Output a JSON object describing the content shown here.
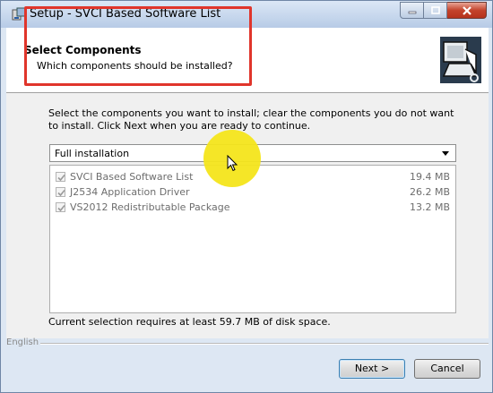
{
  "window": {
    "title": "Setup - SVCI Based Software List"
  },
  "header": {
    "title": "Select Components",
    "subtitle": "Which components should be installed?"
  },
  "main": {
    "instructions": "Select the components you want to install; clear the components you do not want to install. Click Next when you are ready to continue.",
    "install_type": "Full installation",
    "components": [
      {
        "label": "SVCI Based Software List",
        "size": "19.4 MB",
        "checked": true
      },
      {
        "label": "J2534 Application Driver",
        "size": "26.2 MB",
        "checked": true
      },
      {
        "label": "VS2012 Redistributable Package",
        "size": "13.2 MB",
        "checked": true
      }
    ],
    "status": "Current selection requires at least 59.7 MB of disk space."
  },
  "footer": {
    "language": "English",
    "next_label": "Next >",
    "cancel_label": "Cancel"
  },
  "colors": {
    "highlight_box": "#e0352b",
    "cursor_highlight": "#f4e51b"
  }
}
